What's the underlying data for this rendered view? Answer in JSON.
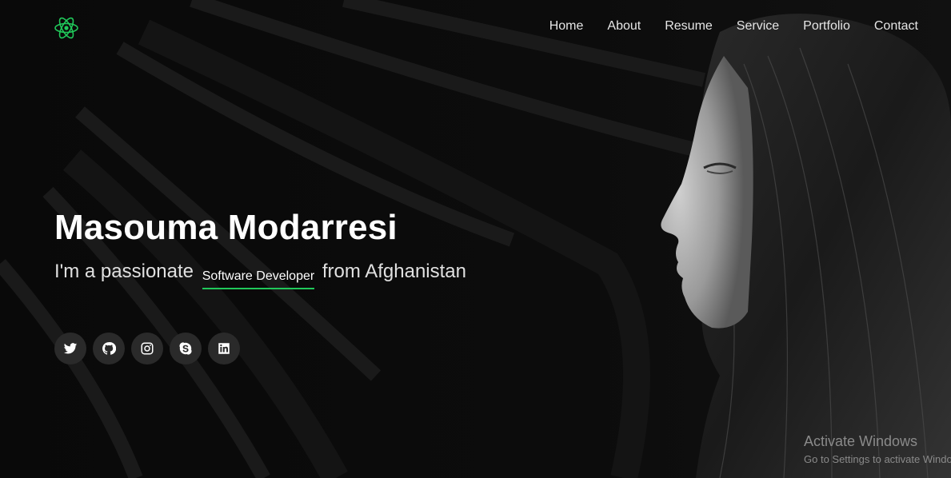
{
  "brand": {
    "logo_icon": "atom-logo-icon",
    "accent_color": "#20c85a"
  },
  "nav": {
    "items": [
      {
        "label": "Home"
      },
      {
        "label": "About"
      },
      {
        "label": "Resume"
      },
      {
        "label": "Service"
      },
      {
        "label": "Portfolio"
      },
      {
        "label": "Contact"
      }
    ]
  },
  "hero": {
    "name": "Masouma Modarresi",
    "tagline_prefix": "I'm a passionate",
    "typed_role": "Software Developer",
    "tagline_suffix": "from Afghanistan"
  },
  "social": [
    {
      "icon": "twitter-icon"
    },
    {
      "icon": "github-icon"
    },
    {
      "icon": "instagram-icon"
    },
    {
      "icon": "skype-icon"
    },
    {
      "icon": "linkedin-icon"
    }
  ],
  "watermark": {
    "title": "Activate Windows",
    "subtitle": "Go to Settings to activate Windows."
  }
}
